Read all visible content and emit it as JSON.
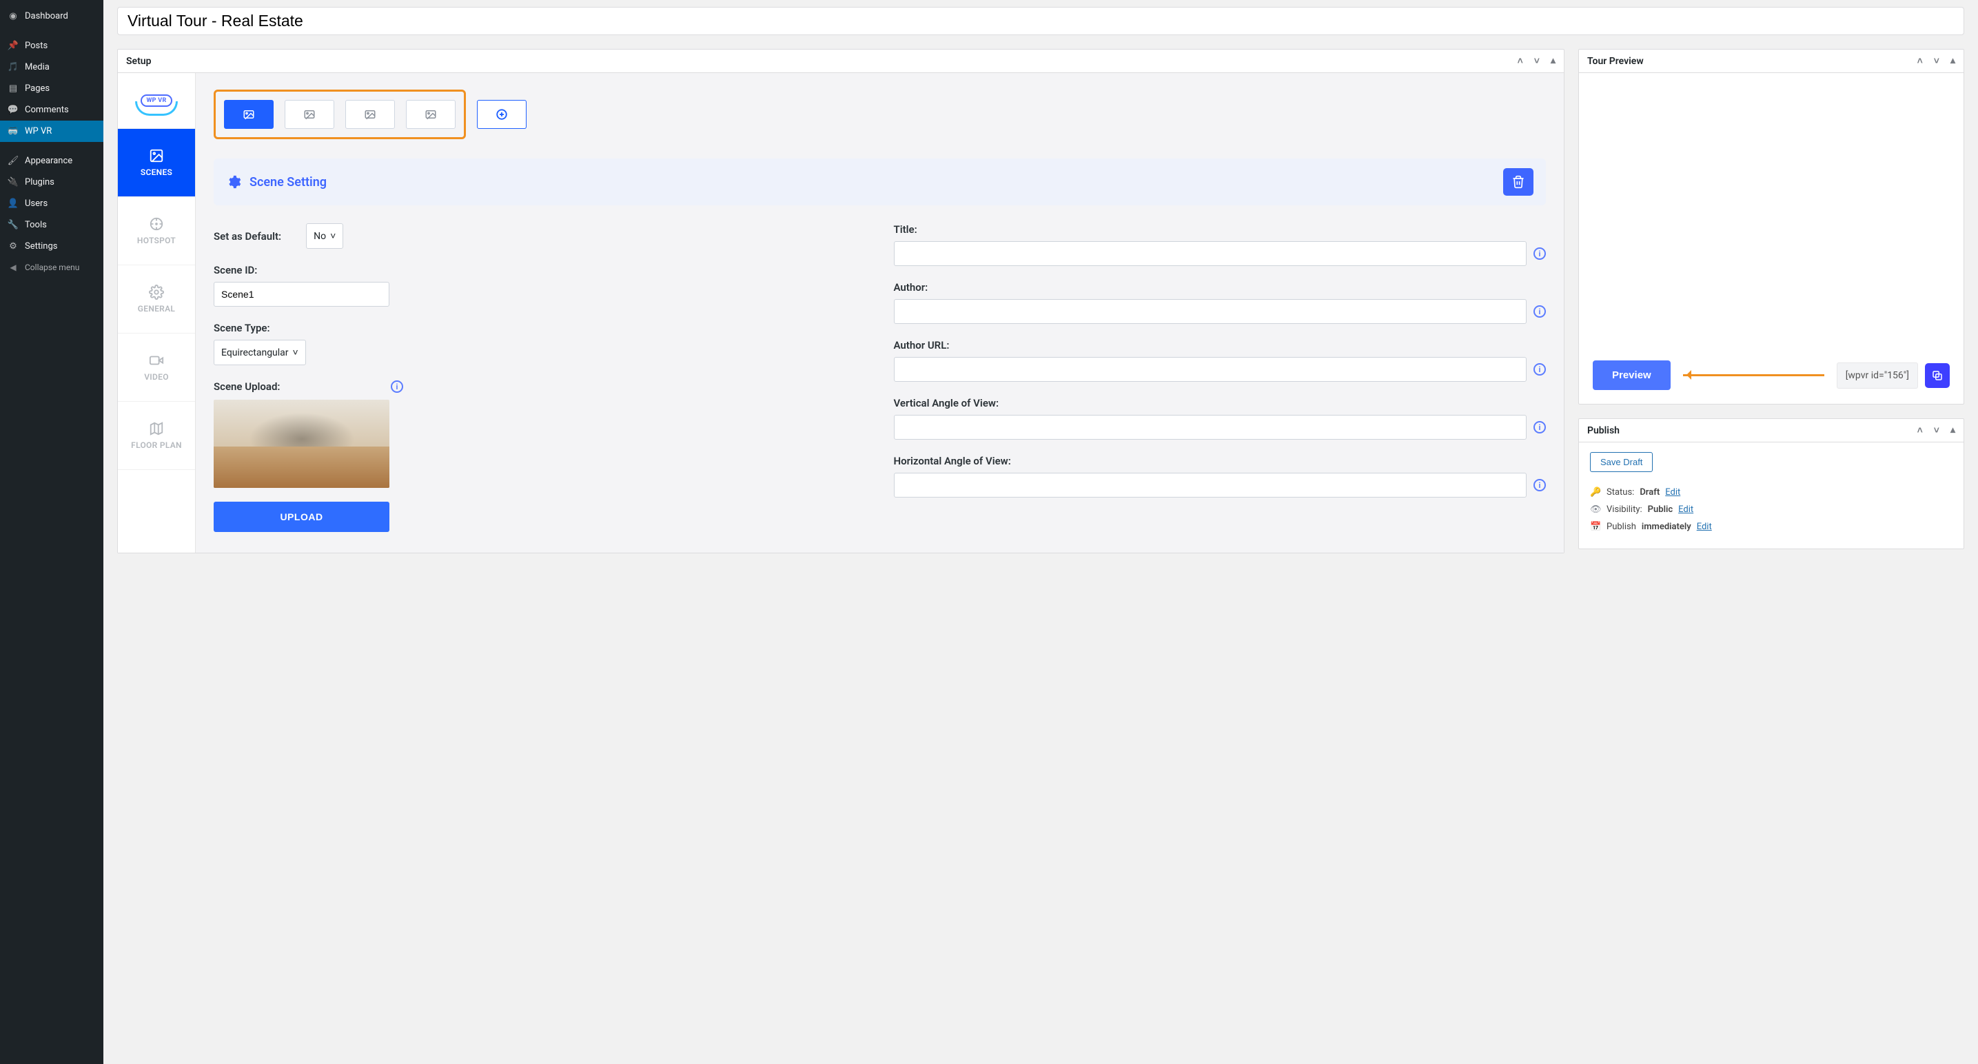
{
  "sidebar": {
    "items": [
      {
        "label": "Dashboard"
      },
      {
        "label": "Posts"
      },
      {
        "label": "Media"
      },
      {
        "label": "Pages"
      },
      {
        "label": "Comments"
      },
      {
        "label": "WP VR"
      },
      {
        "label": "Appearance"
      },
      {
        "label": "Plugins"
      },
      {
        "label": "Users"
      },
      {
        "label": "Tools"
      },
      {
        "label": "Settings"
      },
      {
        "label": "Collapse menu"
      }
    ]
  },
  "page": {
    "title_value": "Virtual Tour - Real Estate"
  },
  "setup": {
    "heading": "Setup",
    "tabs": {
      "logo_text": "WP VR",
      "scenes": "SCENES",
      "hotspot": "HOTSPOT",
      "general": "GENERAL",
      "video": "VIDEO",
      "floor_plan": "FLOOR PLAN"
    },
    "scene_setting_label": "Scene Setting",
    "fields": {
      "set_default_label": "Set as Default:",
      "set_default_value": "No",
      "scene_id_label": "Scene ID:",
      "scene_id_value": "Scene1",
      "scene_type_label": "Scene Type:",
      "scene_type_value": "Equirectangular",
      "scene_upload_label": "Scene Upload:",
      "upload_btn": "UPLOAD",
      "title_label": "Title:",
      "author_label": "Author:",
      "author_url_label": "Author URL:",
      "vav_label": "Vertical Angle of View:",
      "hav_label": "Horizontal Angle of View:"
    }
  },
  "tour_preview": {
    "heading": "Tour Preview",
    "preview_btn": "Preview",
    "shortcode": "[wpvr id=\"156\"]"
  },
  "publish": {
    "heading": "Publish",
    "save_draft": "Save Draft",
    "status_label": "Status:",
    "status_value": "Draft",
    "visibility_label": "Visibility:",
    "visibility_value": "Public",
    "publish_label": "Publish",
    "publish_value": "immediately",
    "edit": "Edit"
  }
}
